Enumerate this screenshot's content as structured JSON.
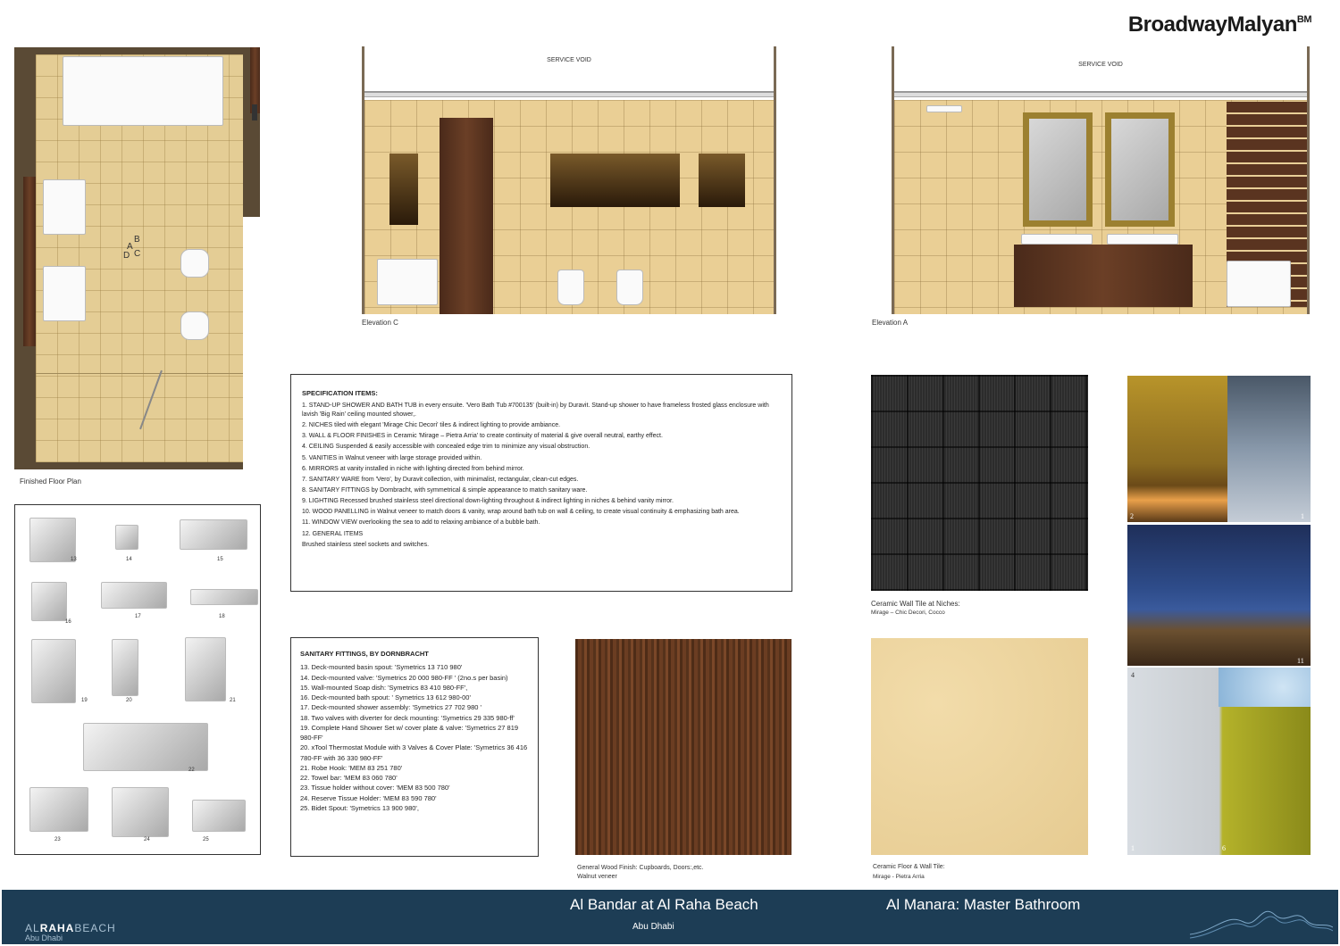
{
  "brand": {
    "name": "BroadwayMalyan",
    "mark": "BM"
  },
  "floor_plan": {
    "caption": "Finished Floor Plan",
    "markers": [
      "A",
      "B",
      "C",
      "D"
    ]
  },
  "elevation_c": {
    "void": "SERVICE VOID",
    "caption": "Elevation C"
  },
  "elevation_a": {
    "void": "SERVICE VOID",
    "caption": "Elevation A"
  },
  "spec": {
    "heading": "SPECIFICATION ITEMS:",
    "items": [
      "1. STAND-UP SHOWER AND BATH TUB in every ensuite. 'Vero Bath Tub #700135' (built-in) by Duravit. Stand-up shower to have frameless frosted glass enclosure with lavish 'Big Rain' ceiling mounted shower,.",
      "2. NICHES tiled with elegant 'Mirage Chic Decori' tiles & indirect lighting to provide ambiance.",
      "3. WALL & FLOOR FINISHES in Ceramic 'Mirage – Pietra Arria' to create continuity of material & give overall neutral, earthy effect.",
      "4. CEILING Suspended & easily accessible with concealed edge trim to minimize any visual obstruction.",
      "5. VANITIES in Walnut veneer with large storage provided within.",
      "6. MIRRORS at vanity installed in niche with lighting directed from behind mirror.",
      "7. SANITARY WARE from 'Vero', by Duravit collection, with minimalist, rectangular, clean-cut edges.",
      "8. SANITARY FITTINGS by Dornbracht, with symmetrical & simple appearance to match sanitary ware.",
      "9. LIGHTING Recessed brushed stainless steel directional down-lighting throughout & indirect lighting in niches & behind vanity mirror.",
      "10. WOOD PANELLING in Walnut veneer to match doors & vanity, wrap around bath tub on wall & ceiling, to create visual continuity & emphasizing bath area.",
      "11. WINDOW VIEW overlooking the sea to add to relaxing ambiance of a bubble bath.",
      "12. GENERAL ITEMS",
      "Brushed stainless steel sockets and switches."
    ]
  },
  "sanitary": {
    "heading": "SANITARY FITTINGS, BY DORNBRACHT",
    "items": [
      "13. Deck-mounted basin spout: 'Symetrics 13 710 980'",
      "14. Deck-mounted valve: 'Symetrics 20 000 980-FF ' (2no.s per basin)",
      "15. Wall-mounted Soap dish: 'Symetrics 83 410 980-FF',",
      "16. Deck-mounted bath spout: ' Symetrics 13 612 980-00'",
      "17. Deck-mounted shower assembly: 'Symetrics 27 702 980 '",
      "18. Two valves with diverter for deck mounting: 'Symetrics 29 335 980-ff'",
      "19. Complete Hand Shower Set w/ cover plate & valve: 'Symetrics 27 819 980-FF'",
      "20. xTool Thermostat Module with 3 Valves & Cover Plate: 'Symetrics 36 416 780-FF with 36 330 980-FF'",
      "21. Robe Hook: 'MEM 83 251 780'",
      "22. Towel bar: 'MEM 83 060 780'",
      "23. Tissue holder without cover: 'MEM 83 500 780'",
      "24. Reserve Tissue Holder: 'MEM 83 590 780'",
      "25. Bidet Spout: 'Symetrics 13 900 980',"
    ]
  },
  "fittings_numbers": [
    "13",
    "14",
    "15",
    "16",
    "17",
    "18",
    "19",
    "20",
    "21",
    "22",
    "23",
    "24",
    "25"
  ],
  "swatches": {
    "wall_tile": {
      "line1": "Ceramic Wall Tile at Niches:",
      "line2": "Mirage – Chic Decori, Cocco"
    },
    "wood": {
      "line1": "General Wood Finish: Cupboards, Doors:,etc.",
      "line2": "Walnut veneer"
    },
    "floor": {
      "line1": "Ceramic Floor & Wall Tile:",
      "line2": "Mirage - Pietra Arria"
    }
  },
  "mood_numbers": [
    "2",
    "1",
    "11",
    "4",
    "1",
    "6"
  ],
  "footer": {
    "project": "Al Bandar at Al Raha Beach",
    "location": "Abu Dhabi",
    "room": "Al Manara: Master Bathroom",
    "logo_a": "AL",
    "logo_b": "RAHA",
    "logo_c": "BEACH",
    "logo_sub": "Abu Dhabi"
  },
  "colors": {
    "footer": "#1d3d55",
    "highlight": "#2b5fb4"
  }
}
